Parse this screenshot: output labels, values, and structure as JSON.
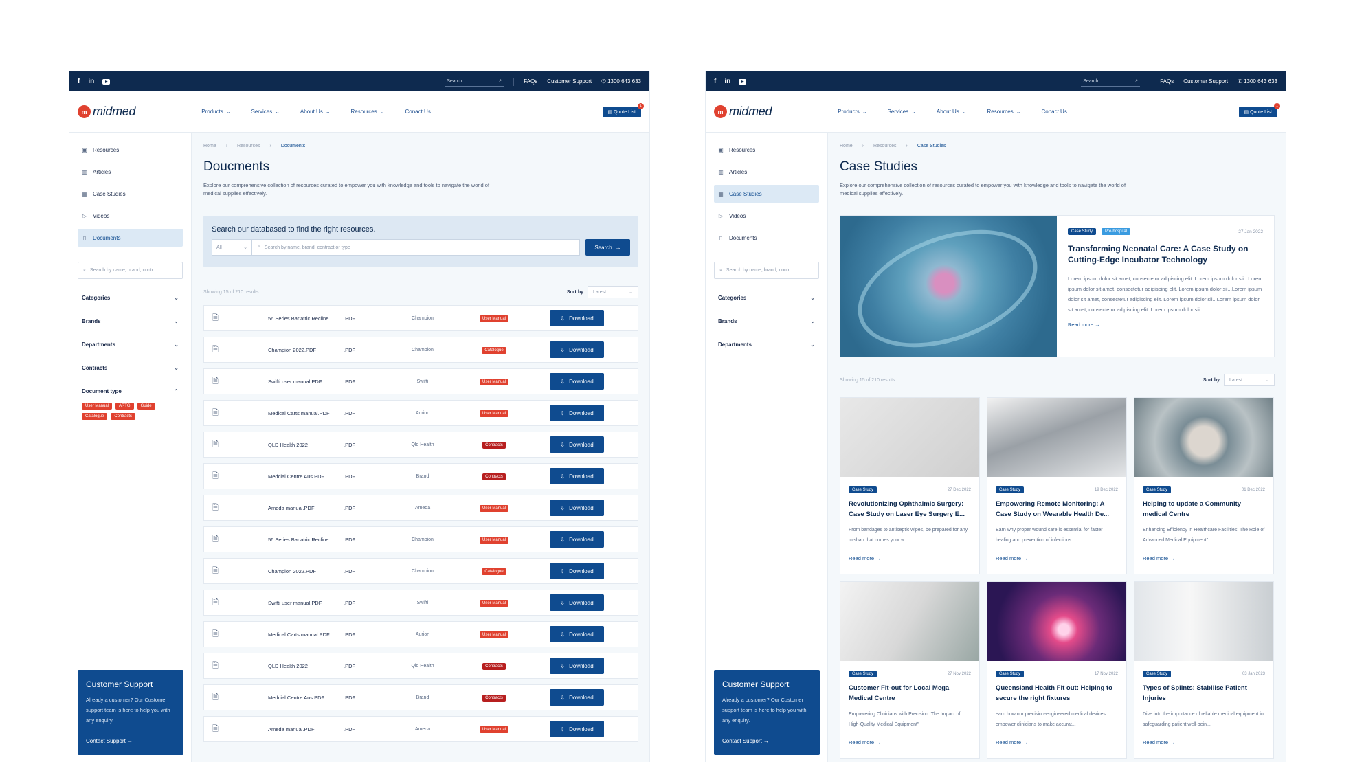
{
  "common": {
    "social": [
      "f",
      "in",
      "yt"
    ],
    "topbar": {
      "search_placeholder": "Search",
      "faqs": "FAQs",
      "support": "Customer Support",
      "phone": "1300 643 633"
    },
    "logo_mark": "m",
    "logo_text": "midmed",
    "nav": [
      "Products",
      "Services",
      "About Us",
      "Resources",
      "Conact Us"
    ],
    "quote": "Quote List",
    "quote_count": "1",
    "side_menu": [
      "Resources",
      "Articles",
      "Case Studies",
      "Videos",
      "Documents"
    ],
    "side_search_placeholder": "Search by name, brand, contr...",
    "support": {
      "title": "Customer Support",
      "text": "Already a customer? Our Customer support team is here to help you with any enquiry.",
      "link": "Contact Support"
    },
    "results": "Showing  15 of 210 results",
    "sort_label": "Sort by",
    "sort_value": "Latest",
    "read_more": "Read more"
  },
  "documents": {
    "crumbs": [
      "Home",
      "Resources",
      "Documents"
    ],
    "title": "Doucments",
    "desc": "Explore our comprehensive collection of resources curated to empower you with knowledge and tools to navigate the world of medical supplies effectively.",
    "filters": [
      "Categories",
      "Brands",
      "Departments",
      "Contracts",
      "Document type"
    ],
    "tags": [
      "User Manual",
      "ARTG",
      "Guide",
      "Catalogue",
      "Contracts"
    ],
    "search_title": "Search our databased to find the right resources.",
    "search_select": "All",
    "search_placeholder": "Search by name, brand, contract or type",
    "search_btn": "Search",
    "download": "Download",
    "rows": [
      {
        "name": "56 Series Bariatric Recline...",
        "type": ".PDF",
        "brand": "Champion",
        "tag": "User Manual"
      },
      {
        "name": "Champion 2022.PDF",
        "type": ".PDF",
        "brand": "Champion",
        "tag": "Catalogue"
      },
      {
        "name": "Swifti user manual.PDF",
        "type": ".PDF",
        "brand": "Swifti",
        "tag": "User Manual"
      },
      {
        "name": "Medical Carts manual.PDF",
        "type": ".PDF",
        "brand": "Aurion",
        "tag": "User Manual"
      },
      {
        "name": "QLD Health 2022",
        "type": ".PDF",
        "brand": "Qld Health",
        "tag": "Contracts"
      },
      {
        "name": "Medcial Centre Aus.PDF",
        "type": ".PDF",
        "brand": "Brand",
        "tag": "Contracts"
      },
      {
        "name": "Ameda manual.PDF",
        "type": ".PDF",
        "brand": "Ameda",
        "tag": "User Manual"
      },
      {
        "name": "56 Series Bariatric Recline...",
        "type": ".PDF",
        "brand": "Champion",
        "tag": "User Manual"
      },
      {
        "name": "Champion 2022.PDF",
        "type": ".PDF",
        "brand": "Champion",
        "tag": "Catalogue"
      },
      {
        "name": "Swifti user manual.PDF",
        "type": ".PDF",
        "brand": "Swifti",
        "tag": "User Manual"
      },
      {
        "name": "Medical Carts manual.PDF",
        "type": ".PDF",
        "brand": "Aurion",
        "tag": "User Manual"
      },
      {
        "name": "QLD Health 2022",
        "type": ".PDF",
        "brand": "Qld Health",
        "tag": "Contracts"
      },
      {
        "name": "Medcial Centre Aus.PDF",
        "type": ".PDF",
        "brand": "Brand",
        "tag": "Contracts"
      },
      {
        "name": "Ameda manual.PDF",
        "type": ".PDF",
        "brand": "Ameda",
        "tag": "User Manual"
      }
    ]
  },
  "case_studies": {
    "crumbs": [
      "Home",
      "Resources",
      "Case Studies"
    ],
    "title": "Case Studies",
    "desc": "Explore our comprehensive collection of resources curated to empower you with knowledge and tools to navigate the world of medical supplies effectively.",
    "filters": [
      "Categories",
      "Brands",
      "Departments"
    ],
    "featured": {
      "tags": [
        "Case Study",
        "Pre-hospital"
      ],
      "date": "27 Jan 2022",
      "title": "Transforming Neonatal Care: A Case Study on Cutting-Edge Incubator Technology",
      "text": "Lorem ipsum dolor sit amet, consectetur adipiscing elit. Lorem ipsum dolor sii...Lorem ipsum dolor sit amet, consectetur adipiscing elit. Lorem ipsum dolor sii...Lorem ipsum dolor sit amet, consectetur adipiscing elit. Lorem ipsum dolor sii...Lorem ipsum dolor sit amet, consectetur adipiscing elit. Lorem ipsum dolor sii..."
    },
    "cards": [
      {
        "tag": "Case Study",
        "date": "27 Dec 2022",
        "title": "Revolutionizing Ophthalmic Surgery: Case Study on Laser Eye Surgery E...",
        "text": "From bandages to antiseptic wipes, be prepared for any mishap that comes your w..."
      },
      {
        "tag": "Case Study",
        "date": "19 Dec 2022",
        "title": "Empowering Remote Monitoring: A Case Study on Wearable Health De...",
        "text": "Earn why proper wound care is essential for faster healing and prevention of infections."
      },
      {
        "tag": "Case Study",
        "date": "01 Dec 2022",
        "title": "Helping to update a Community medical Centre",
        "text": "Enhancing Efficiency in Healthcare Facilities: The Role of Advanced Medical Equipment\""
      },
      {
        "tag": "Case Study",
        "date": "27 Nov 2022",
        "title": "Customer Fit-out for Local Mega Medical Centre",
        "text": "Empowering Clinicians with Precision: The Impact of High-Quality Medical Equipment\""
      },
      {
        "tag": "Case Study",
        "date": "17 Nov 2022",
        "title": "Queensland Health Fit out: Helping to secure the right fixtures",
        "text": "earn how our precision-engineered medical devices empower clinicians to make accurat..."
      },
      {
        "tag": "Case Study",
        "date": "03 Jan 2023",
        "title": "Types of Splints: Stabilise Patient Injuries",
        "text": "Dive into the importance of reliable medical equipment in safeguarding patient well-bein..."
      }
    ]
  }
}
